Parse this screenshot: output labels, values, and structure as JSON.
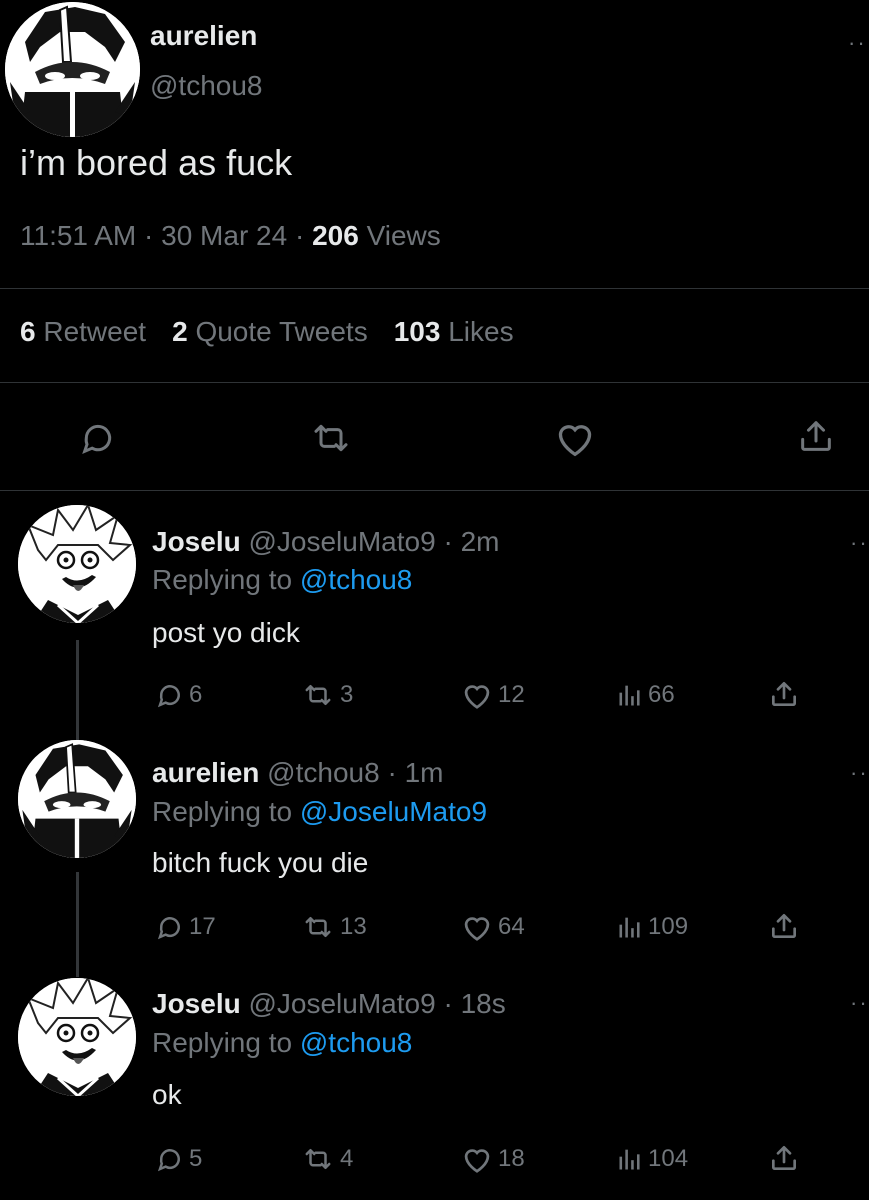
{
  "main_tweet": {
    "author_name": "aurelien",
    "author_handle": "@tchou8",
    "text": "i’m bored as fuck",
    "time": "11:51 AM",
    "date": "30 Mar 24",
    "views_count": "206",
    "views_label": "Views",
    "retweets_count": "6",
    "retweets_label": "Retweet",
    "quotes_count": "2",
    "quotes_label": "Quote Tweets",
    "likes_count": "103",
    "likes_label": "Likes",
    "more_label": "··"
  },
  "replies": [
    {
      "name": "Joselu",
      "handle": "@JoseluMato9",
      "time": "2m",
      "replying_prefix": "Replying to",
      "replying_to": "@tchou8",
      "text": "post yo dick",
      "replies": "6",
      "retweets": "3",
      "likes": "12",
      "views": "66",
      "more_label": "··"
    },
    {
      "name": "aurelien",
      "handle": "@tchou8",
      "time": "1m",
      "replying_prefix": "Replying to",
      "replying_to": "@JoseluMato9",
      "text": "bitch fuck you die",
      "replies": "17",
      "retweets": "13",
      "likes": "64",
      "views": "109",
      "more_label": "··"
    },
    {
      "name": "Joselu",
      "handle": "@JoseluMato9",
      "time": "18s",
      "replying_prefix": "Replying to",
      "replying_to": "@tchou8",
      "text": "ok",
      "replies": "5",
      "retweets": "4",
      "likes": "18",
      "views": "104",
      "more_label": "··"
    }
  ],
  "separator": "·",
  "colors": {
    "background": "#000000",
    "text": "#e7e9ea",
    "muted": "#71767b",
    "link": "#1d9bf0"
  },
  "icons": [
    "reply-icon",
    "retweet-icon",
    "like-icon",
    "views-icon",
    "share-icon"
  ]
}
